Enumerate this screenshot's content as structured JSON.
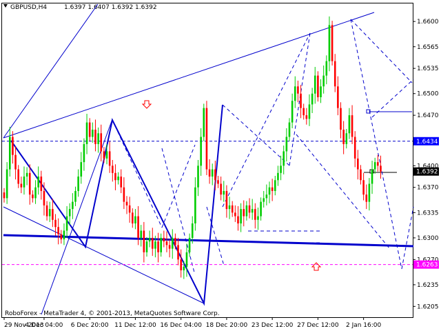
{
  "header": {
    "symbol": "GBPUSD,H4",
    "ohlc": "1.6397 1.6407 1.6392 1.6392"
  },
  "footer": {
    "copyright": "RoboForex - MetaTrader 4, © 2001-2013, MetaQuotes Software Corp."
  },
  "chart_data": {
    "type": "candlestick",
    "symbol": "GBPUSD",
    "timeframe": "H4",
    "ylim": [
      1.619,
      1.6625
    ],
    "y_ticks": [
      "1.6600",
      "1.6565",
      "1.6535",
      "1.6500",
      "1.6470",
      "1.6400",
      "1.6370",
      "1.6335",
      "1.6300",
      "1.6270",
      "1.6235",
      "1.6205"
    ],
    "y_tick_values": [
      1.66,
      1.6565,
      1.6535,
      1.65,
      1.647,
      1.64,
      1.637,
      1.6335,
      1.63,
      1.627,
      1.6235,
      1.6205
    ],
    "x_ticks": [
      "29 Nov 2013",
      "4 Dec 04:00",
      "6 Dec 20:00",
      "11 Dec 12:00",
      "16 Dec 04:00",
      "18 Dec 20:00",
      "23 Dec 12:00",
      "27 Dec 12:00",
      "2 Jan 16:00"
    ],
    "x_tick_index": [
      0,
      14,
      30,
      46,
      62,
      78,
      94,
      110,
      126
    ],
    "bar_count": 143,
    "price_labels": [
      {
        "text": "1.6434",
        "value": 1.6434,
        "color": "#0000ff"
      },
      {
        "text": "1.6392",
        "value": 1.6392,
        "color": "#000000"
      },
      {
        "text": "1.6263",
        "value": 1.6263,
        "color": "#ff00ff"
      }
    ],
    "levels": [
      {
        "value": 1.6434,
        "style": "dashed",
        "color": "#0000cc"
      },
      {
        "value": 1.6263,
        "style": "dashed",
        "color": "#ff00ff"
      }
    ],
    "closes": [
      1.6355,
      1.6395,
      1.644,
      1.6415,
      1.6395,
      1.6375,
      1.637,
      1.6385,
      1.639,
      1.636,
      1.6355,
      1.637,
      1.6385,
      1.6365,
      1.6345,
      1.633,
      1.634,
      1.6325,
      1.6315,
      1.6305,
      1.6298,
      1.631,
      1.633,
      1.634,
      1.635,
      1.6365,
      1.6385,
      1.6405,
      1.643,
      1.646,
      1.644,
      1.645,
      1.643,
      1.6445,
      1.642,
      1.641,
      1.642,
      1.64,
      1.639,
      1.638,
      1.6385,
      1.637,
      1.635,
      1.6345,
      1.6335,
      1.632,
      1.633,
      1.63,
      1.631,
      1.628,
      1.6295,
      1.63,
      1.6285,
      1.6295,
      1.628,
      1.63,
      1.6295,
      1.629,
      1.6285,
      1.63,
      1.629,
      1.627,
      1.6255,
      1.626,
      1.628,
      1.63,
      1.632,
      1.637,
      1.64,
      1.644,
      1.648,
      1.6395,
      1.6385,
      1.6395,
      1.638,
      1.6375,
      1.636,
      1.6365,
      1.634,
      1.6345,
      1.6335,
      1.633,
      1.632,
      1.634,
      1.633,
      1.6345,
      1.6335,
      1.634,
      1.6325,
      1.633,
      1.635,
      1.6355,
      1.636,
      1.637,
      1.6365,
      1.638,
      1.639,
      1.64,
      1.642,
      1.644,
      1.646,
      1.649,
      1.651,
      1.65,
      1.648,
      1.647,
      1.6465,
      1.6485,
      1.65,
      1.6525,
      1.6495,
      1.651,
      1.6525,
      1.6545,
      1.6595,
      1.6545,
      1.651,
      1.648,
      1.645,
      1.643,
      1.6445,
      1.647,
      1.644,
      1.641,
      1.6395,
      1.638,
      1.636,
      1.635,
      1.6375,
      1.6395,
      1.6405,
      1.64,
      1.6392
    ]
  },
  "colors": {
    "bull": "#00cc00",
    "bear": "#ff0000",
    "trend": "#0000cc",
    "text": "#000000"
  }
}
